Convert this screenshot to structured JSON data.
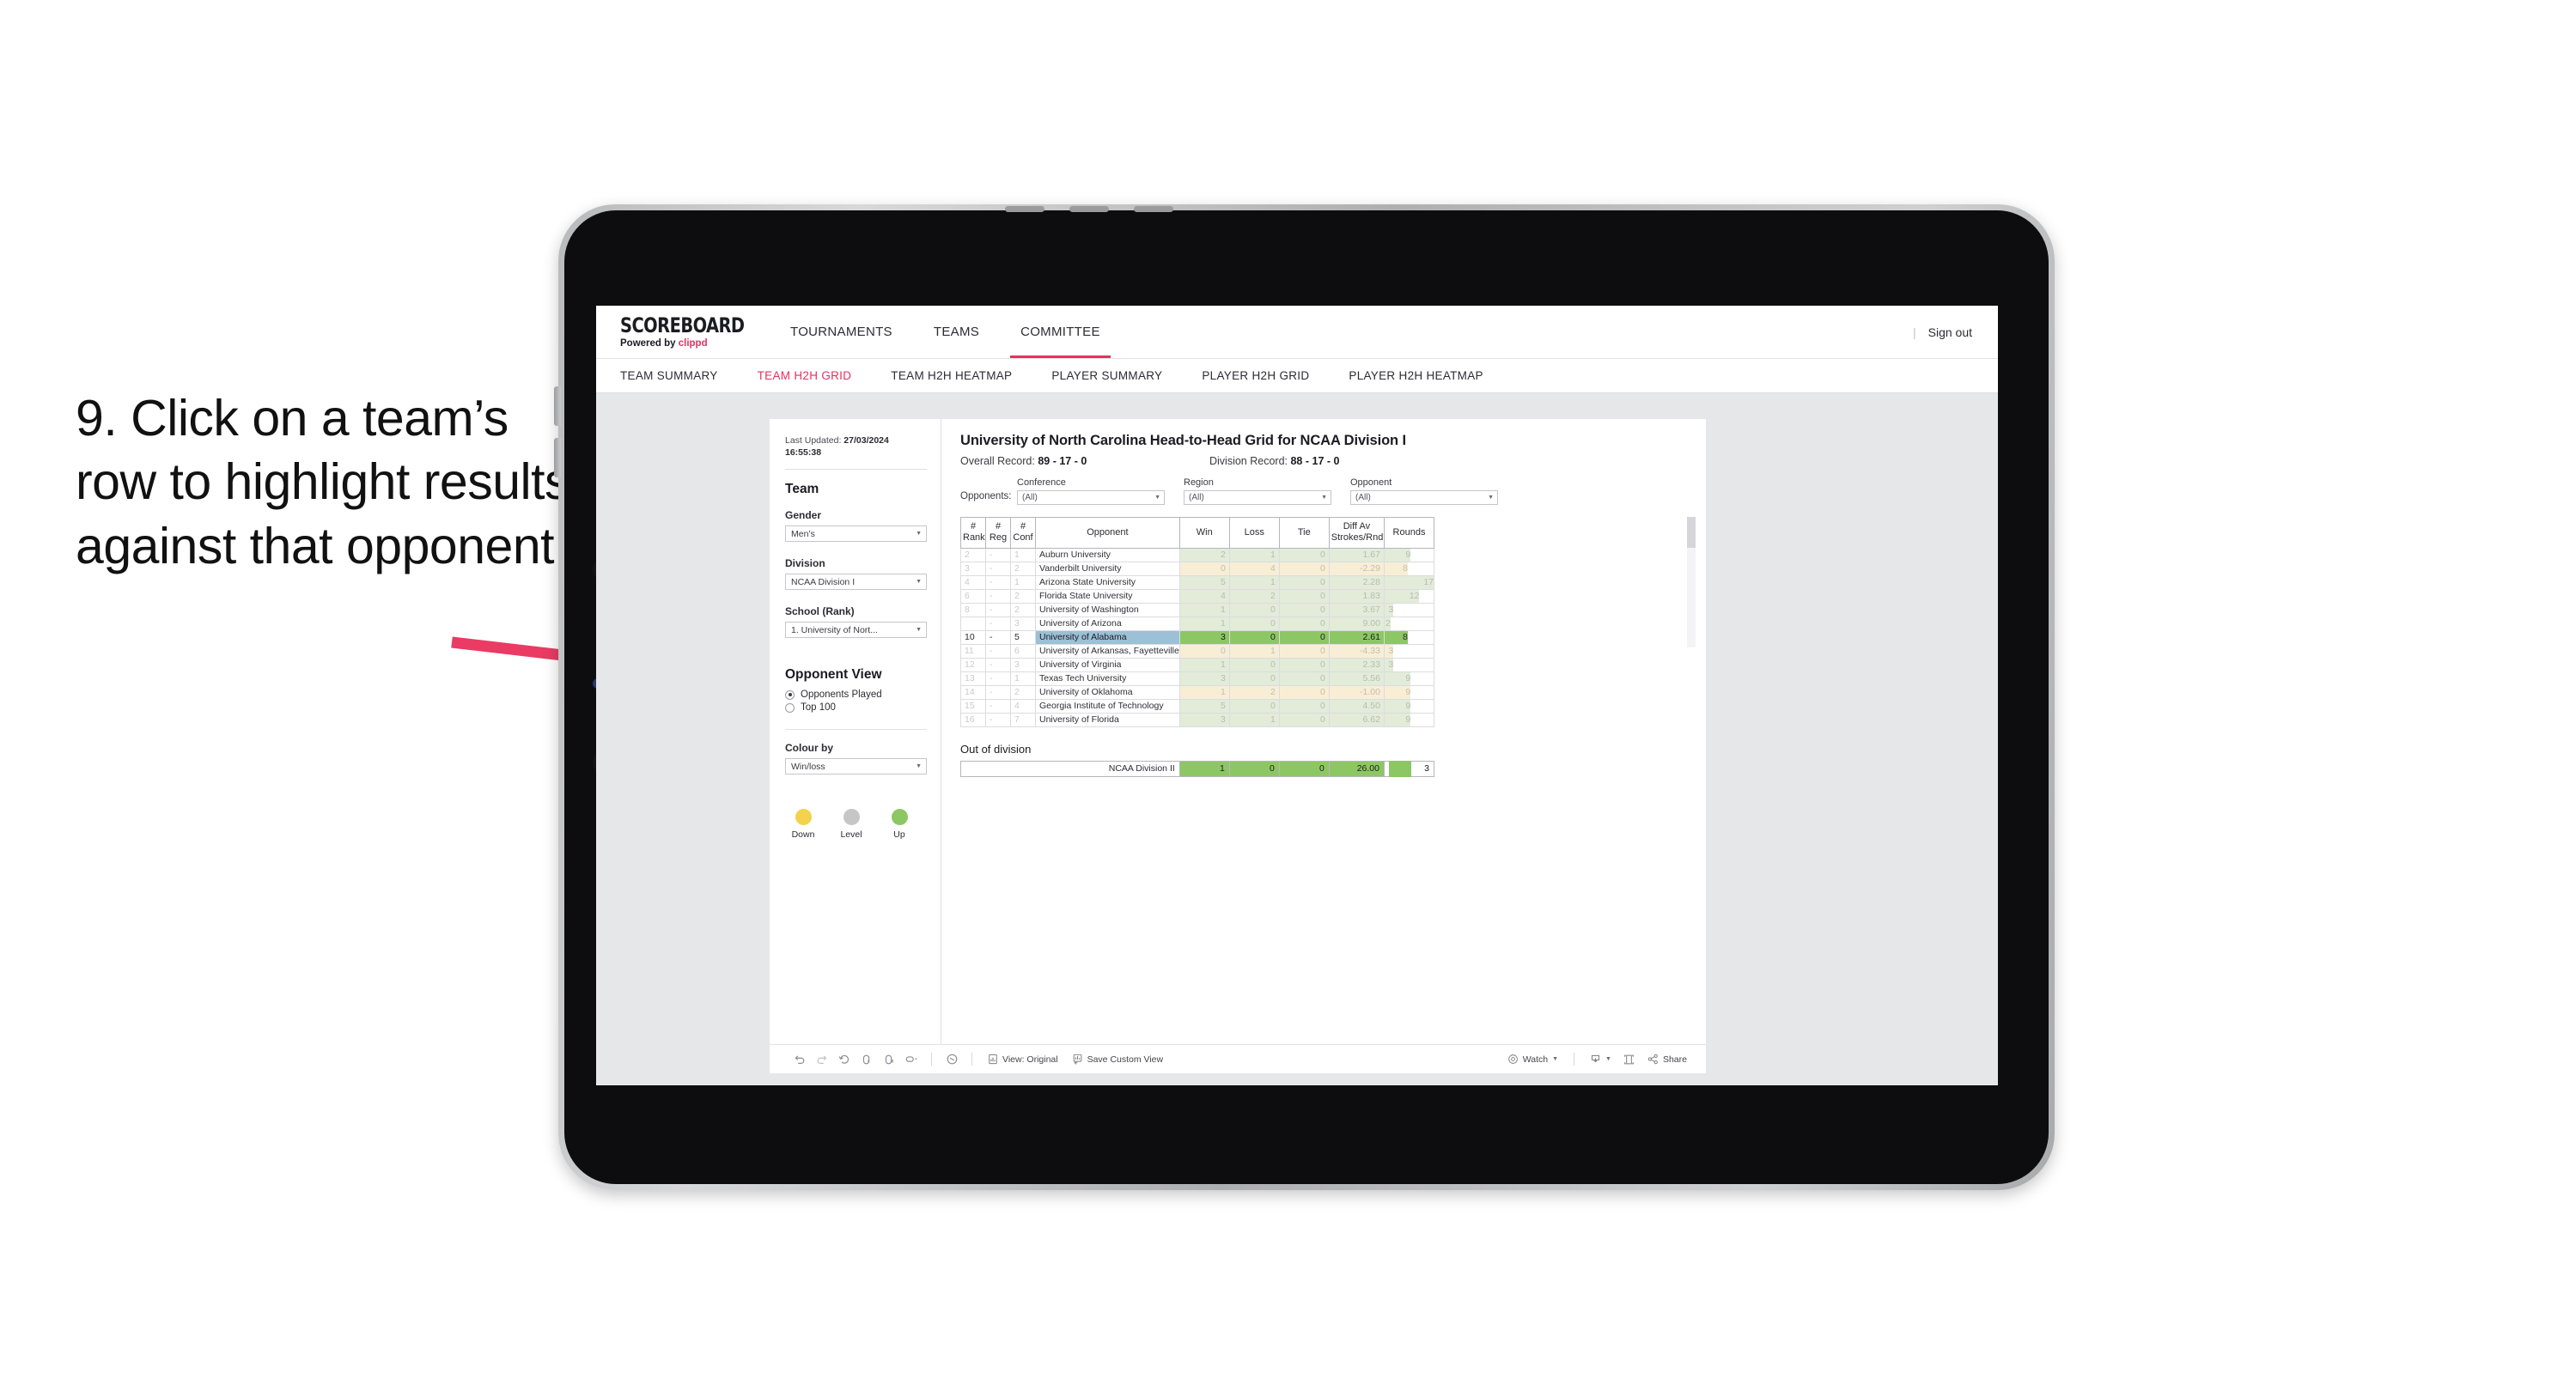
{
  "annotation": {
    "text": "9. Click on a team’s row to highlight results against that opponent",
    "arrow_color": "#ea3b64"
  },
  "topnav": {
    "brand_title": "SCOREBOARD",
    "brand_sub_prefix": "Powered by ",
    "brand_sub_name": "clippd",
    "items": [
      {
        "label": "TOURNAMENTS",
        "active": false
      },
      {
        "label": "TEAMS",
        "active": false
      },
      {
        "label": "COMMITTEE",
        "active": true
      }
    ],
    "divider": "|",
    "signout": "Sign out"
  },
  "subnav": {
    "items": [
      {
        "label": "TEAM SUMMARY",
        "active": false
      },
      {
        "label": "TEAM H2H GRID",
        "active": true
      },
      {
        "label": "TEAM H2H HEATMAP",
        "active": false
      },
      {
        "label": "PLAYER SUMMARY",
        "active": false
      },
      {
        "label": "PLAYER H2H GRID",
        "active": false
      },
      {
        "label": "PLAYER H2H HEATMAP",
        "active": false
      }
    ],
    "accent": "#e8305f"
  },
  "filters": {
    "last_updated_label": "Last Updated: ",
    "last_updated_value": "27/03/2024 16:55:38",
    "team_heading": "Team",
    "gender_label": "Gender",
    "gender_value": "Men’s",
    "division_label": "Division",
    "division_value": "NCAA Division I",
    "school_label": "School (Rank)",
    "school_value": "1. University of Nort...",
    "opponent_view_heading": "Opponent View",
    "opponent_view_options": [
      {
        "label": "Opponents Played",
        "selected": true
      },
      {
        "label": "Top 100",
        "selected": false
      }
    ],
    "colour_by_label": "Colour by",
    "colour_by_value": "Win/loss",
    "legend": [
      {
        "label": "Down",
        "color": "#f3d24e"
      },
      {
        "label": "Level",
        "color": "#c4c6c8"
      },
      {
        "label": "Up",
        "color": "#8dc763"
      }
    ]
  },
  "content": {
    "title": "University of North Carolina Head-to-Head Grid for NCAA Division I",
    "overall_record_label": "Overall Record: ",
    "overall_record_value": "89 - 17 - 0",
    "division_record_label": "Division Record: ",
    "division_record_value": "88 - 17 - 0",
    "opponents_label": "Opponents:",
    "opponent_filters": [
      {
        "label": "Conference",
        "value": "(All)"
      },
      {
        "label": "Region",
        "value": "(All)"
      },
      {
        "label": "Opponent",
        "value": "(All)"
      }
    ],
    "columns": [
      "# Rank",
      "# Reg",
      "# Conf",
      "Opponent",
      "Win",
      "Loss",
      "Tie",
      "Diff Av Strokes/Rnd",
      "Rounds"
    ],
    "column_parts": {
      "rank": [
        "#",
        "Rank"
      ],
      "reg": [
        "#",
        "Reg"
      ],
      "conf": [
        "#",
        "Conf"
      ],
      "opponent": "Opponent",
      "win": "Win",
      "loss": "Loss",
      "tie": "Tie",
      "diff": [
        "Diff Av",
        "Strokes/Rnd"
      ],
      "rounds": "Rounds"
    },
    "rows": [
      {
        "rank": "2",
        "reg": "-",
        "conf": "1",
        "opponent": "Auburn University",
        "win": "2",
        "loss": "1",
        "tie": "0",
        "diff": "1.67",
        "rounds": "9",
        "tone": "up",
        "highlight": false
      },
      {
        "rank": "3",
        "reg": "-",
        "conf": "2",
        "opponent": "Vanderbilt University",
        "win": "0",
        "loss": "4",
        "tie": "0",
        "diff": "-2.29",
        "rounds": "8",
        "tone": "down",
        "highlight": false
      },
      {
        "rank": "4",
        "reg": "-",
        "conf": "1",
        "opponent": "Arizona State University",
        "win": "5",
        "loss": "1",
        "tie": "0",
        "diff": "2.28",
        "rounds": "17",
        "tone": "up",
        "highlight": false
      },
      {
        "rank": "6",
        "reg": "-",
        "conf": "2",
        "opponent": "Florida State University",
        "win": "4",
        "loss": "2",
        "tie": "0",
        "diff": "1.83",
        "rounds": "12",
        "tone": "up",
        "highlight": false
      },
      {
        "rank": "8",
        "reg": "-",
        "conf": "2",
        "opponent": "University of Washington",
        "win": "1",
        "loss": "0",
        "tie": "0",
        "diff": "3.67",
        "rounds": "3",
        "tone": "up",
        "highlight": false
      },
      {
        "rank": "",
        "reg": "-",
        "conf": "3",
        "opponent": "University of Arizona",
        "win": "1",
        "loss": "0",
        "tie": "0",
        "diff": "9.00",
        "rounds": "2",
        "tone": "up",
        "highlight": false
      },
      {
        "rank": "10",
        "reg": "-",
        "conf": "5",
        "opponent": "University of Alabama",
        "win": "3",
        "loss": "0",
        "tie": "0",
        "diff": "2.61",
        "rounds": "8",
        "tone": "up",
        "highlight": true
      },
      {
        "rank": "11",
        "reg": "-",
        "conf": "6",
        "opponent": "University of Arkansas, Fayetteville",
        "win": "0",
        "loss": "1",
        "tie": "0",
        "diff": "-4.33",
        "rounds": "3",
        "tone": "down",
        "highlight": false
      },
      {
        "rank": "12",
        "reg": "-",
        "conf": "3",
        "opponent": "University of Virginia",
        "win": "1",
        "loss": "0",
        "tie": "0",
        "diff": "2.33",
        "rounds": "3",
        "tone": "up",
        "highlight": false
      },
      {
        "rank": "13",
        "reg": "-",
        "conf": "1",
        "opponent": "Texas Tech University",
        "win": "3",
        "loss": "0",
        "tie": "0",
        "diff": "5.56",
        "rounds": "9",
        "tone": "up",
        "highlight": false
      },
      {
        "rank": "14",
        "reg": "-",
        "conf": "2",
        "opponent": "University of Oklahoma",
        "win": "1",
        "loss": "2",
        "tie": "0",
        "diff": "-1.00",
        "rounds": "9",
        "tone": "down",
        "highlight": false
      },
      {
        "rank": "15",
        "reg": "-",
        "conf": "4",
        "opponent": "Georgia Institute of Technology",
        "win": "5",
        "loss": "0",
        "tie": "0",
        "diff": "4.50",
        "rounds": "9",
        "tone": "up",
        "highlight": false
      },
      {
        "rank": "16",
        "reg": "-",
        "conf": "7",
        "opponent": "University of Florida",
        "win": "3",
        "loss": "1",
        "tie": "0",
        "diff": "6.62",
        "rounds": "9",
        "tone": "up",
        "highlight": false
      }
    ],
    "out_of_division_title": "Out of division",
    "out_of_division_row": {
      "label": "NCAA Division II",
      "win": "1",
      "loss": "0",
      "tie": "0",
      "diff": "26.00",
      "rounds": "3"
    },
    "colors": {
      "up_fill": "#e2ecd9",
      "down_fill": "#f8eed5",
      "highlight_row": "#9cc0d6",
      "highlight_value": "#8dc763",
      "accent": "#e8305f"
    }
  },
  "toolbar": {
    "icons": [
      "undo-icon",
      "redo-icon",
      "revert-icon",
      "refresh-icon",
      "pause-icon",
      "replay-icon"
    ],
    "view_label": "View: Original",
    "save_label": "Save Custom View",
    "watch_label": "Watch",
    "share_label": "Share"
  }
}
